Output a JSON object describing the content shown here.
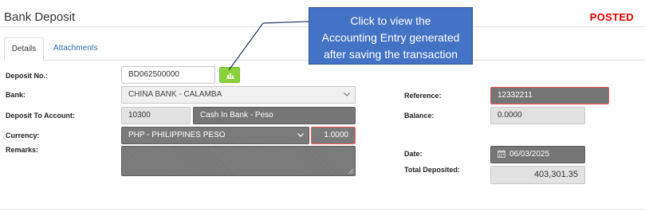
{
  "page": {
    "title": "Bank Deposit",
    "status": "POSTED"
  },
  "tabs": [
    {
      "label": "Details",
      "active": true
    },
    {
      "label": "Attachments",
      "active": false
    }
  ],
  "form": {
    "deposit_no": {
      "label": "Deposit No.:",
      "value": "BD062500000"
    },
    "bank": {
      "label": "Bank:",
      "value": "CHINA BANK - CALAMBA"
    },
    "deposit_to_account": {
      "label": "Deposit To Account:",
      "code": "10300",
      "name": "Cash In Bank - Peso"
    },
    "currency": {
      "label": "Currency:",
      "value": "PHP - PHILIPPINES PESO",
      "rate": "1.0000"
    },
    "remarks": {
      "label": "Remarks:",
      "value": ""
    },
    "reference": {
      "label": "Reference:",
      "value": "12332211"
    },
    "balance": {
      "label": "Balance:",
      "value": "0.0000"
    },
    "date": {
      "label": "Date:",
      "value": "06/03/2025"
    },
    "total_deposited": {
      "label": "Total Deposited:",
      "value": "403,301.35"
    }
  },
  "callout": {
    "line1": "Click to view the",
    "line2": "Accounting Entry generated",
    "line3": "after saving the transaction"
  },
  "icons": {
    "chart_button": "bar-chart-icon",
    "date_field": "calendar-icon",
    "select_arrow": "chevron-down-icon"
  },
  "colors": {
    "status": "#e00000",
    "chart_button": "#8ad23c",
    "callout": "#4472c4",
    "tab_link": "#2a6bb5",
    "readonly_field": "#767676",
    "invalid_border": "#ee5555"
  }
}
